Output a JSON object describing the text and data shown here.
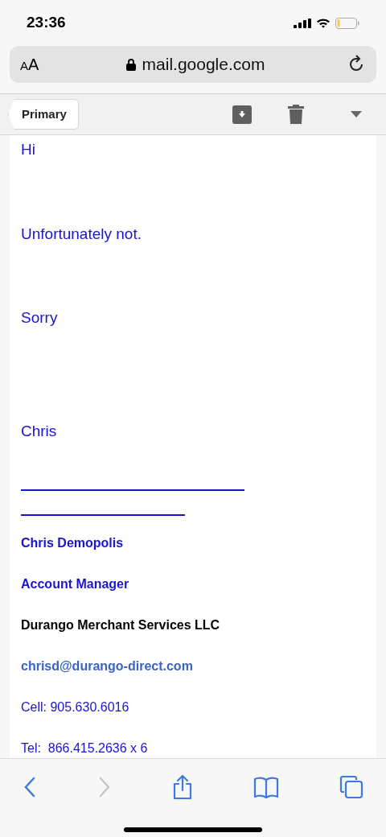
{
  "status_bar": {
    "time": "23:36"
  },
  "address_bar": {
    "text_size_label": "AA",
    "url": "mail.google.com"
  },
  "mail_toolbar": {
    "back_label": "Primary"
  },
  "message": {
    "body": [
      {
        "kind": "line",
        "text": "Hi"
      },
      {
        "kind": "line",
        "text": "Unfortunately not."
      },
      {
        "kind": "line",
        "text": "Sorry"
      },
      {
        "kind": "line",
        "text": "Chris"
      }
    ],
    "signature": [
      {
        "kind": "name",
        "text": "Chris Demopolis"
      },
      {
        "kind": "title",
        "text": "Account Manager"
      },
      {
        "kind": "company",
        "text": "Durango Merchant Services LLC"
      },
      {
        "kind": "email",
        "text": "chrisd@durango-direct.com"
      },
      {
        "kind": "phone",
        "text": "Cell: 905.630.6016"
      },
      {
        "kind": "phone",
        "text": "Tel:  866.415.2636 x 6"
      }
    ]
  },
  "browser_toolbar": {
    "back_disabled": false,
    "forward_disabled": true
  }
}
